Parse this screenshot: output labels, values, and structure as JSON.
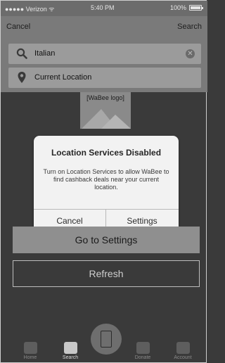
{
  "status_bar": {
    "carrier": "●●●●● Verizon ᯤ",
    "time": "5:40 PM",
    "battery": "100%"
  },
  "header": {
    "cancel_label": "Cancel",
    "search_label": "Search"
  },
  "search_field": {
    "value": "Italian",
    "clear_glyph": "✕"
  },
  "location_field": {
    "value": "Current Location"
  },
  "logo": {
    "caption": "[WaBee logo]"
  },
  "dialog": {
    "title": "Location Services Disabled",
    "message": "Turn on Location Services to allow WaBee to find cashback deals near your current location.",
    "cancel_label": "Cancel",
    "settings_label": "Settings"
  },
  "buttons": {
    "go_to_settings": "Go to Settings",
    "refresh": "Refresh"
  },
  "tabs": [
    {
      "label": "Home",
      "icon": "home-icon"
    },
    {
      "label": "Search",
      "icon": "search-tab-icon",
      "active": true
    },
    {
      "label": "",
      "icon": "phone-icon"
    },
    {
      "label": "Donate",
      "icon": "donate-icon"
    },
    {
      "label": "Account",
      "icon": "account-icon"
    }
  ],
  "colors": {
    "background": "#3a3a3a",
    "header": "#7a7a7a",
    "dialog": "#f2f2f2",
    "primary_button": "#8f8f8f"
  }
}
